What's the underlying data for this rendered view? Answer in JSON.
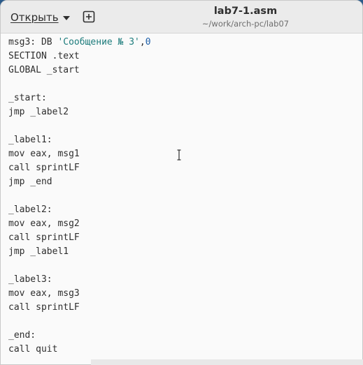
{
  "header": {
    "open_label": "Открыть",
    "title": "lab7-1.asm",
    "path": "~/work/arch-pc/lab07"
  },
  "code": {
    "lines": [
      {
        "parts": [
          {
            "t": "msg3: DB "
          },
          {
            "t": "'Сообщение № 3'",
            "c": "str"
          },
          {
            "t": ","
          },
          {
            "t": "0",
            "c": "num"
          }
        ]
      },
      {
        "parts": [
          {
            "t": "SECTION .text"
          }
        ]
      },
      {
        "parts": [
          {
            "t": "GLOBAL _start"
          }
        ]
      },
      {
        "parts": [
          {
            "t": ""
          }
        ]
      },
      {
        "parts": [
          {
            "t": "_start:"
          }
        ]
      },
      {
        "parts": [
          {
            "t": "jmp _label2"
          }
        ]
      },
      {
        "parts": [
          {
            "t": ""
          }
        ]
      },
      {
        "parts": [
          {
            "t": "_label1:"
          }
        ]
      },
      {
        "parts": [
          {
            "t": "mov eax, msg1"
          }
        ]
      },
      {
        "parts": [
          {
            "t": "call sprintLF"
          }
        ]
      },
      {
        "parts": [
          {
            "t": "jmp _end"
          }
        ]
      },
      {
        "parts": [
          {
            "t": ""
          }
        ]
      },
      {
        "parts": [
          {
            "t": "_label2:"
          }
        ]
      },
      {
        "parts": [
          {
            "t": "mov eax, msg2"
          }
        ]
      },
      {
        "parts": [
          {
            "t": "call sprintLF"
          }
        ]
      },
      {
        "parts": [
          {
            "t": "jmp _label1"
          }
        ]
      },
      {
        "parts": [
          {
            "t": ""
          }
        ]
      },
      {
        "parts": [
          {
            "t": "_label3:"
          }
        ]
      },
      {
        "parts": [
          {
            "t": "mov eax, msg3"
          }
        ]
      },
      {
        "parts": [
          {
            "t": "call sprintLF"
          }
        ]
      },
      {
        "parts": [
          {
            "t": ""
          }
        ]
      },
      {
        "parts": [
          {
            "t": "_end:"
          }
        ]
      },
      {
        "parts": [
          {
            "t": "call quit"
          }
        ]
      }
    ]
  },
  "icons": {
    "open_menu": "chevron-down-icon",
    "new_tab": "new-tab-icon",
    "cursor": "text-cursor-icon"
  }
}
